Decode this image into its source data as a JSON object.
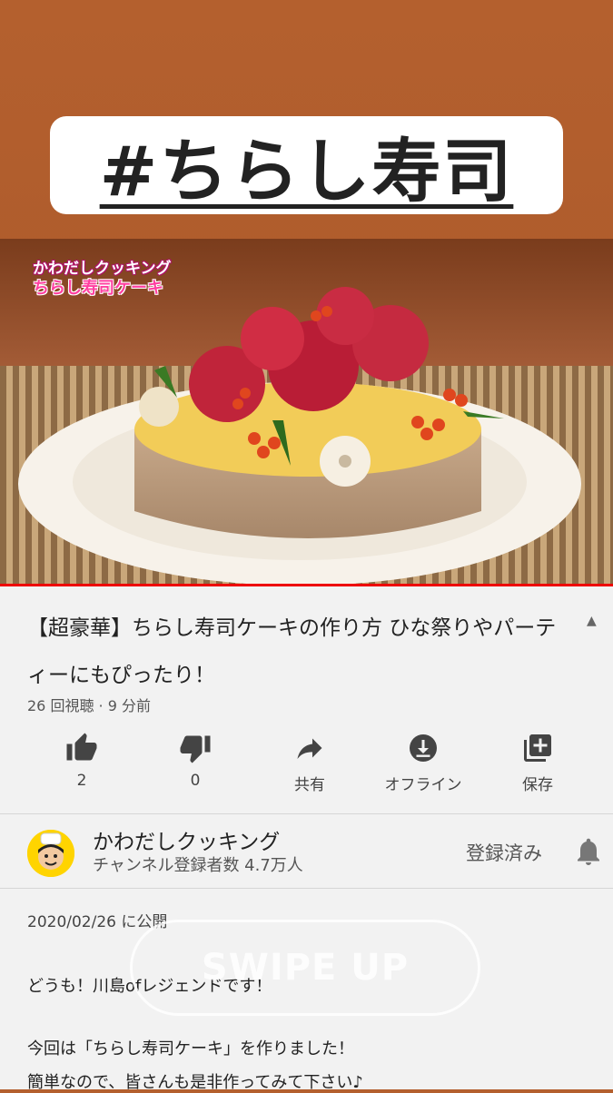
{
  "hashtag": "#ちらし寿司",
  "video": {
    "overlay_line1": "かわだしクッキング",
    "overlay_line2": "ちらし寿司ケーキ"
  },
  "video_info": {
    "title": "【超豪華】ちらし寿司ケーキの作り方 ひな祭りやパーティーにもぴったり！",
    "meta": "26 回視聴 · 9 分前"
  },
  "actions": {
    "like": "2",
    "dislike": "0",
    "share": "共有",
    "offline": "オフライン",
    "save": "保存"
  },
  "channel": {
    "name": "かわだしクッキング",
    "subscribers": "チャンネル登録者数 4.7万人",
    "subscribed_label": "登録済み"
  },
  "description": {
    "date": "2020/02/26 に公開",
    "line1": "どうも！川島ofレジェンドです！",
    "line2": "今回は「ちらし寿司ケーキ」を作りました！",
    "line3": "簡単なので、皆さんも是非作ってみて下さい♪"
  },
  "swipe_up": "SWIPE UP",
  "colors": {
    "background": "#a9572a",
    "progress": "#ee0000",
    "overlay_pink": "#ff3fa0"
  }
}
